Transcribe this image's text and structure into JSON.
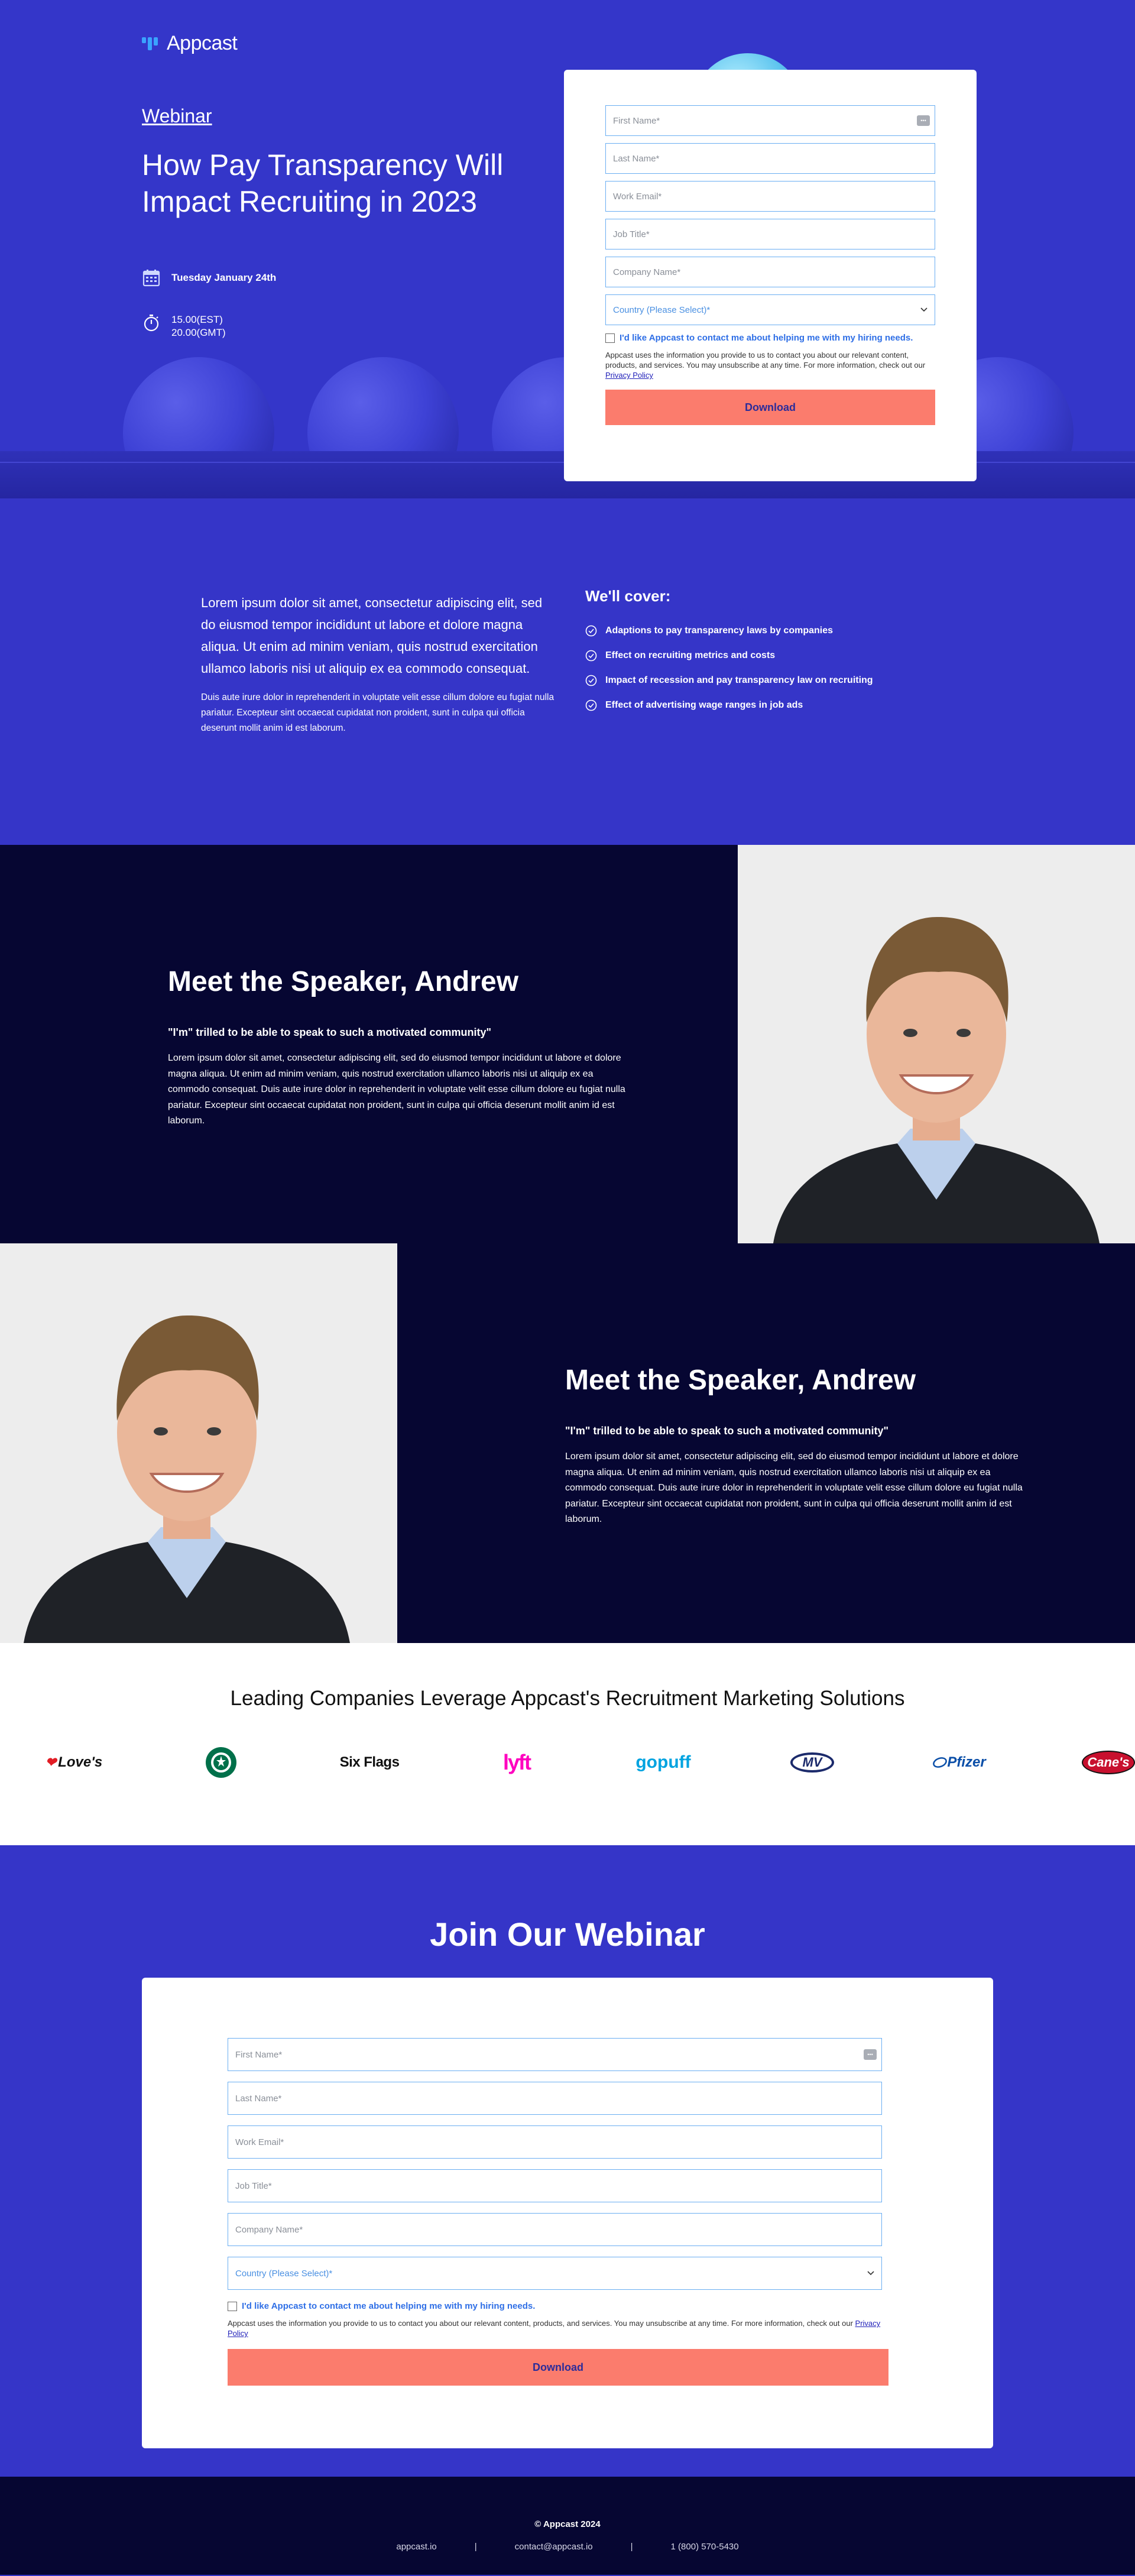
{
  "brand": {
    "name": "Appcast"
  },
  "hero": {
    "tag": "Webinar",
    "title": "How Pay Transparency Will Impact Recruiting in 2023",
    "date": "Tuesday January 24th",
    "time_est": "15.00(EST)",
    "time_gmt": "20.00(GMT)"
  },
  "form": {
    "first_name": "First Name*",
    "last_name": "Last Name*",
    "work_email": "Work Email*",
    "job_title": "Job Title*",
    "company_name": "Company Name*",
    "country": "Country (Please Select)*",
    "opt_in": "I'd like Appcast to contact me about helping me with my hiring needs.",
    "consent": "Appcast uses the information you provide to us to contact you about our relevant content, products, and services. You may unsubscribe at any time. For more information, check out our",
    "privacy_link": "Privacy Policy",
    "submit": "Download"
  },
  "cover": {
    "lead": "Lorem ipsum dolor sit amet, consectetur adipiscing elit, sed do eiusmod tempor incididunt ut labore et dolore magna aliqua. Ut enim ad minim veniam, quis nostrud exercitation ullamco laboris nisi ut aliquip ex ea commodo consequat.",
    "small": "Duis aute irure dolor in reprehenderit in voluptate velit esse cillum dolore eu fugiat nulla pariatur. Excepteur sint occaecat cupidatat non proident, sunt in culpa qui officia deserunt mollit anim id est laborum.",
    "heading": "We'll cover:",
    "items": [
      "Adaptions to pay transparency laws by companies",
      "Effect on recruiting metrics and costs",
      "Impact of recession and pay transparency law on recruiting",
      "Effect of advertising wage ranges in  job ads"
    ]
  },
  "speakers": [
    {
      "heading": "Meet the Speaker, Andrew",
      "quote": "\"I'm\" trilled to be able to speak to such a motivated community\"",
      "bio": "Lorem ipsum dolor sit amet, consectetur adipiscing elit, sed do eiusmod tempor incididunt ut labore et dolore magna aliqua. Ut enim ad minim veniam, quis nostrud exercitation ullamco laboris nisi ut aliquip ex ea commodo consequat. Duis aute irure dolor in reprehenderit in voluptate velit esse cillum dolore eu fugiat nulla pariatur. Excepteur sint occaecat cupidatat non proident, sunt in culpa qui officia deserunt mollit anim id est laborum."
    },
    {
      "heading": "Meet the Speaker, Andrew",
      "quote": "\"I'm\" trilled to be able to speak to such a motivated community\"",
      "bio": "Lorem ipsum dolor sit amet, consectetur adipiscing elit, sed do eiusmod tempor incididunt ut labore et dolore magna aliqua. Ut enim ad minim veniam, quis nostrud exercitation ullamco laboris nisi ut aliquip ex ea commodo consequat. Duis aute irure dolor in reprehenderit in voluptate velit esse cillum dolore eu fugiat nulla pariatur. Excepteur sint occaecat cupidatat non proident, sunt in culpa qui officia deserunt mollit anim id est laborum."
    }
  ],
  "logos": {
    "heading": "Leading Companies Leverage Appcast's Recruitment Marketing Solutions",
    "brands": [
      "Love's",
      "Starbucks",
      "Six Flags",
      "lyft",
      "gopuff",
      "MV",
      "Pfizer",
      "Cane's"
    ]
  },
  "join": {
    "heading": "Join Our Webinar"
  },
  "footer": {
    "copyright": "© Appcast 2024",
    "site": "appcast.io",
    "email": "contact@appcast.io",
    "phone": "1 (800) 570-5430",
    "separator": "|"
  },
  "colors": {
    "primary_blue": "#3535c8",
    "navy": "#060632",
    "cta_coral": "#fb7c6d",
    "field_border": "#6aaef2",
    "link_blue": "#2f6fe6"
  }
}
